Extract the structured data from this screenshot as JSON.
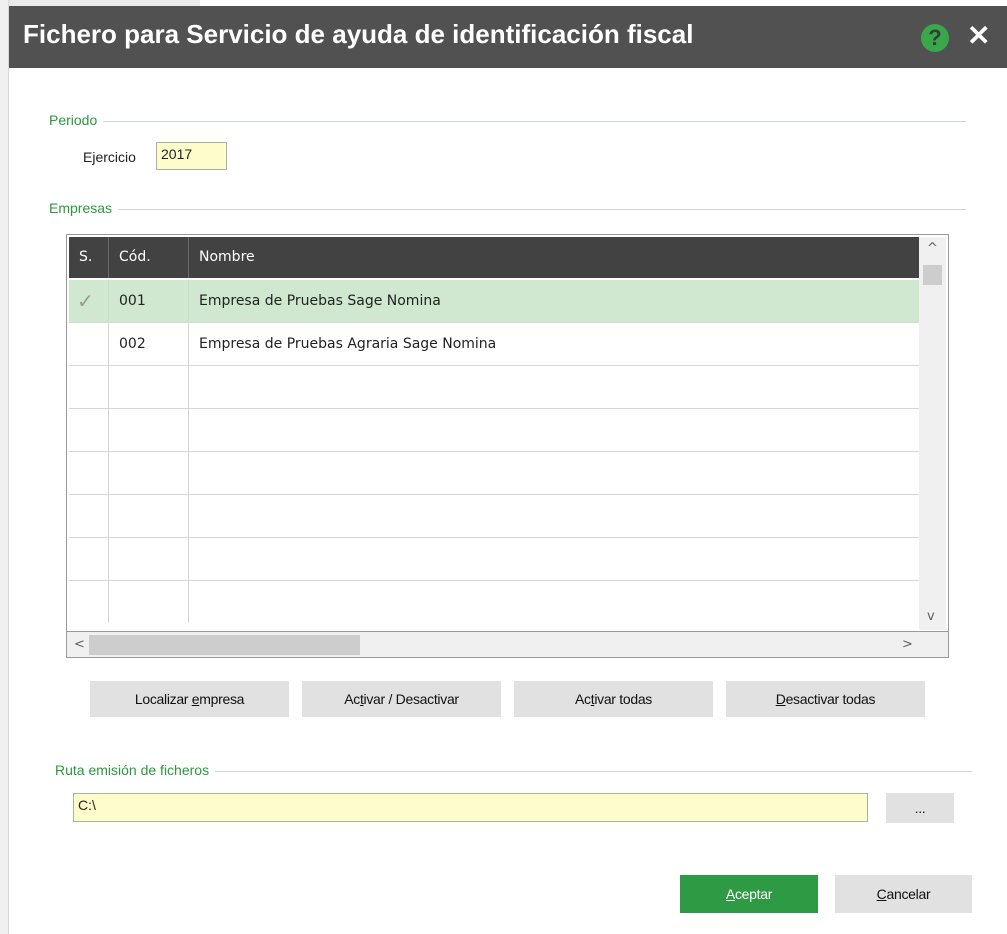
{
  "dialog": {
    "title": "Fichero para Servicio de ayuda de identificación fiscal",
    "help_glyph": "?",
    "close_glyph": "✕",
    "colors": {
      "titlebar": "#515151",
      "accent": "#2e9a43",
      "field_bg": "#fdfdcc",
      "selected_row": "#cfe8cf"
    }
  },
  "periodo": {
    "section_title": "Periodo",
    "ejercicio_label": "Ejercicio",
    "ejercicio_value": "2017"
  },
  "empresas": {
    "section_title": "Empresas",
    "columns": [
      "S.",
      "Cód.",
      "Nombre"
    ],
    "rows": [
      {
        "selected": true,
        "check_icon": "✓",
        "code": "001",
        "name": "Empresa de Pruebas Sage Nomina"
      },
      {
        "selected": false,
        "check_icon": "",
        "code": "002",
        "name": "Empresa de Pruebas Agraria Sage Nomina"
      },
      {
        "selected": false,
        "check_icon": "",
        "code": "",
        "name": ""
      },
      {
        "selected": false,
        "check_icon": "",
        "code": "",
        "name": ""
      },
      {
        "selected": false,
        "check_icon": "",
        "code": "",
        "name": ""
      },
      {
        "selected": false,
        "check_icon": "",
        "code": "",
        "name": ""
      },
      {
        "selected": false,
        "check_icon": "",
        "code": "",
        "name": ""
      },
      {
        "selected": false,
        "check_icon": "",
        "code": "",
        "name": ""
      }
    ],
    "scroll_up": "^",
    "scroll_down": "v",
    "scroll_left": "<",
    "scroll_right": ">"
  },
  "actions": {
    "localizar": {
      "before": "Localizar ",
      "u": "e",
      "after": "mpresa"
    },
    "activar_desactivar": {
      "before": "Ac",
      "u": "t",
      "after": "ivar / Desactivar"
    },
    "activar_todas": {
      "before": "Ac",
      "u": "t",
      "after": "ivar todas"
    },
    "desactivar_todas": {
      "before": "",
      "u": "D",
      "after": "esactivar todas"
    }
  },
  "ruta": {
    "section_title": "Ruta emisión de ficheros",
    "value": "C:\\",
    "browse_label": "..."
  },
  "footer": {
    "aceptar": {
      "before": "",
      "u": "A",
      "after": "ceptar"
    },
    "cancelar": {
      "before": "",
      "u": "C",
      "after": "ancelar"
    }
  }
}
